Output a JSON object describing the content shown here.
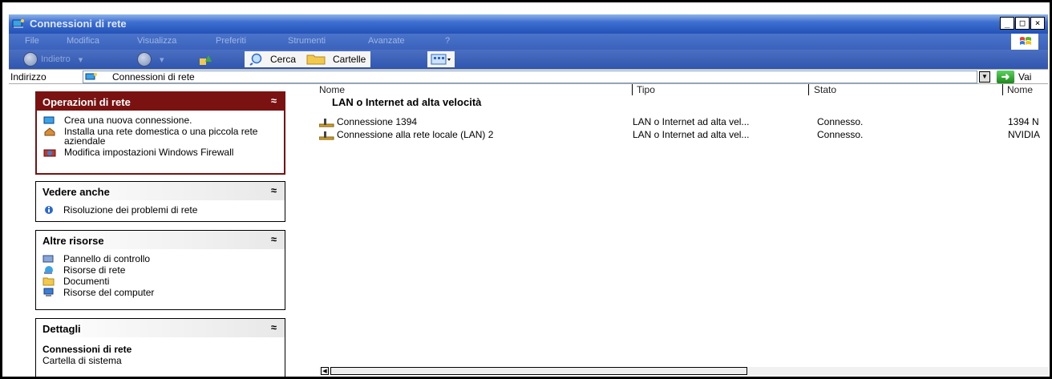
{
  "window": {
    "title": "Connessioni di rete",
    "controls": [
      "_",
      "□",
      "×"
    ]
  },
  "menubar": {
    "items": [
      "File",
      "Modifica",
      "Visualizza",
      "Preferiti",
      "Strumenti",
      "Avanzate",
      "?"
    ]
  },
  "toolbar": {
    "back_label": "Indietro",
    "search_label": "Cerca",
    "folders_label": "Cartelle"
  },
  "address": {
    "label": "Indirizzo",
    "value": "Connessioni di rete",
    "go_label": "Vai"
  },
  "sidebar": {
    "network_tasks": {
      "title": "Operazioni di rete",
      "items": [
        "Crea una nuova connessione.",
        "Installa una rete domestica o una piccola rete aziendale",
        "Modifica impostazioni Windows Firewall"
      ]
    },
    "see_also": {
      "title": "Vedere anche",
      "items": [
        "Risoluzione dei problemi di rete"
      ]
    },
    "other_places": {
      "title": "Altre risorse",
      "items": [
        "Pannello di controllo",
        "Risorse di rete",
        "Documenti",
        "Risorse del computer"
      ]
    },
    "details": {
      "title": "Dettagli",
      "name": "Connessioni di rete",
      "subtitle": "Cartella di sistema"
    }
  },
  "list": {
    "columns": [
      "Nome",
      "Tipo",
      "Stato",
      "Nome"
    ],
    "group": "LAN o Internet ad alta velocità",
    "rows": [
      {
        "name": "Connessione 1394",
        "type": "LAN o Internet ad alta vel...",
        "status": "Connesso.",
        "device": "1394 N"
      },
      {
        "name": "Connessione alla rete locale (LAN) 2",
        "type": "LAN o Internet ad alta vel...",
        "status": "Connesso.",
        "device": "NVIDIA"
      }
    ]
  }
}
